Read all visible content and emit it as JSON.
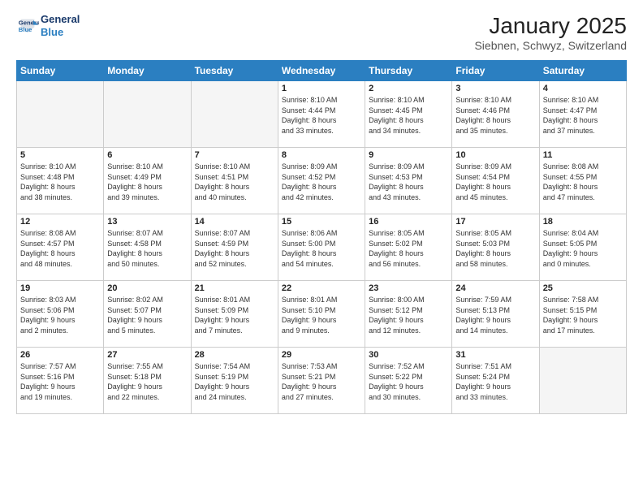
{
  "header": {
    "logo_line1": "General",
    "logo_line2": "Blue",
    "month_title": "January 2025",
    "location": "Siebnen, Schwyz, Switzerland"
  },
  "weekdays": [
    "Sunday",
    "Monday",
    "Tuesday",
    "Wednesday",
    "Thursday",
    "Friday",
    "Saturday"
  ],
  "weeks": [
    [
      {
        "day": "",
        "info": ""
      },
      {
        "day": "",
        "info": ""
      },
      {
        "day": "",
        "info": ""
      },
      {
        "day": "1",
        "info": "Sunrise: 8:10 AM\nSunset: 4:44 PM\nDaylight: 8 hours\nand 33 minutes."
      },
      {
        "day": "2",
        "info": "Sunrise: 8:10 AM\nSunset: 4:45 PM\nDaylight: 8 hours\nand 34 minutes."
      },
      {
        "day": "3",
        "info": "Sunrise: 8:10 AM\nSunset: 4:46 PM\nDaylight: 8 hours\nand 35 minutes."
      },
      {
        "day": "4",
        "info": "Sunrise: 8:10 AM\nSunset: 4:47 PM\nDaylight: 8 hours\nand 37 minutes."
      }
    ],
    [
      {
        "day": "5",
        "info": "Sunrise: 8:10 AM\nSunset: 4:48 PM\nDaylight: 8 hours\nand 38 minutes."
      },
      {
        "day": "6",
        "info": "Sunrise: 8:10 AM\nSunset: 4:49 PM\nDaylight: 8 hours\nand 39 minutes."
      },
      {
        "day": "7",
        "info": "Sunrise: 8:10 AM\nSunset: 4:51 PM\nDaylight: 8 hours\nand 40 minutes."
      },
      {
        "day": "8",
        "info": "Sunrise: 8:09 AM\nSunset: 4:52 PM\nDaylight: 8 hours\nand 42 minutes."
      },
      {
        "day": "9",
        "info": "Sunrise: 8:09 AM\nSunset: 4:53 PM\nDaylight: 8 hours\nand 43 minutes."
      },
      {
        "day": "10",
        "info": "Sunrise: 8:09 AM\nSunset: 4:54 PM\nDaylight: 8 hours\nand 45 minutes."
      },
      {
        "day": "11",
        "info": "Sunrise: 8:08 AM\nSunset: 4:55 PM\nDaylight: 8 hours\nand 47 minutes."
      }
    ],
    [
      {
        "day": "12",
        "info": "Sunrise: 8:08 AM\nSunset: 4:57 PM\nDaylight: 8 hours\nand 48 minutes."
      },
      {
        "day": "13",
        "info": "Sunrise: 8:07 AM\nSunset: 4:58 PM\nDaylight: 8 hours\nand 50 minutes."
      },
      {
        "day": "14",
        "info": "Sunrise: 8:07 AM\nSunset: 4:59 PM\nDaylight: 8 hours\nand 52 minutes."
      },
      {
        "day": "15",
        "info": "Sunrise: 8:06 AM\nSunset: 5:00 PM\nDaylight: 8 hours\nand 54 minutes."
      },
      {
        "day": "16",
        "info": "Sunrise: 8:05 AM\nSunset: 5:02 PM\nDaylight: 8 hours\nand 56 minutes."
      },
      {
        "day": "17",
        "info": "Sunrise: 8:05 AM\nSunset: 5:03 PM\nDaylight: 8 hours\nand 58 minutes."
      },
      {
        "day": "18",
        "info": "Sunrise: 8:04 AM\nSunset: 5:05 PM\nDaylight: 9 hours\nand 0 minutes."
      }
    ],
    [
      {
        "day": "19",
        "info": "Sunrise: 8:03 AM\nSunset: 5:06 PM\nDaylight: 9 hours\nand 2 minutes."
      },
      {
        "day": "20",
        "info": "Sunrise: 8:02 AM\nSunset: 5:07 PM\nDaylight: 9 hours\nand 5 minutes."
      },
      {
        "day": "21",
        "info": "Sunrise: 8:01 AM\nSunset: 5:09 PM\nDaylight: 9 hours\nand 7 minutes."
      },
      {
        "day": "22",
        "info": "Sunrise: 8:01 AM\nSunset: 5:10 PM\nDaylight: 9 hours\nand 9 minutes."
      },
      {
        "day": "23",
        "info": "Sunrise: 8:00 AM\nSunset: 5:12 PM\nDaylight: 9 hours\nand 12 minutes."
      },
      {
        "day": "24",
        "info": "Sunrise: 7:59 AM\nSunset: 5:13 PM\nDaylight: 9 hours\nand 14 minutes."
      },
      {
        "day": "25",
        "info": "Sunrise: 7:58 AM\nSunset: 5:15 PM\nDaylight: 9 hours\nand 17 minutes."
      }
    ],
    [
      {
        "day": "26",
        "info": "Sunrise: 7:57 AM\nSunset: 5:16 PM\nDaylight: 9 hours\nand 19 minutes."
      },
      {
        "day": "27",
        "info": "Sunrise: 7:55 AM\nSunset: 5:18 PM\nDaylight: 9 hours\nand 22 minutes."
      },
      {
        "day": "28",
        "info": "Sunrise: 7:54 AM\nSunset: 5:19 PM\nDaylight: 9 hours\nand 24 minutes."
      },
      {
        "day": "29",
        "info": "Sunrise: 7:53 AM\nSunset: 5:21 PM\nDaylight: 9 hours\nand 27 minutes."
      },
      {
        "day": "30",
        "info": "Sunrise: 7:52 AM\nSunset: 5:22 PM\nDaylight: 9 hours\nand 30 minutes."
      },
      {
        "day": "31",
        "info": "Sunrise: 7:51 AM\nSunset: 5:24 PM\nDaylight: 9 hours\nand 33 minutes."
      },
      {
        "day": "",
        "info": ""
      }
    ]
  ]
}
